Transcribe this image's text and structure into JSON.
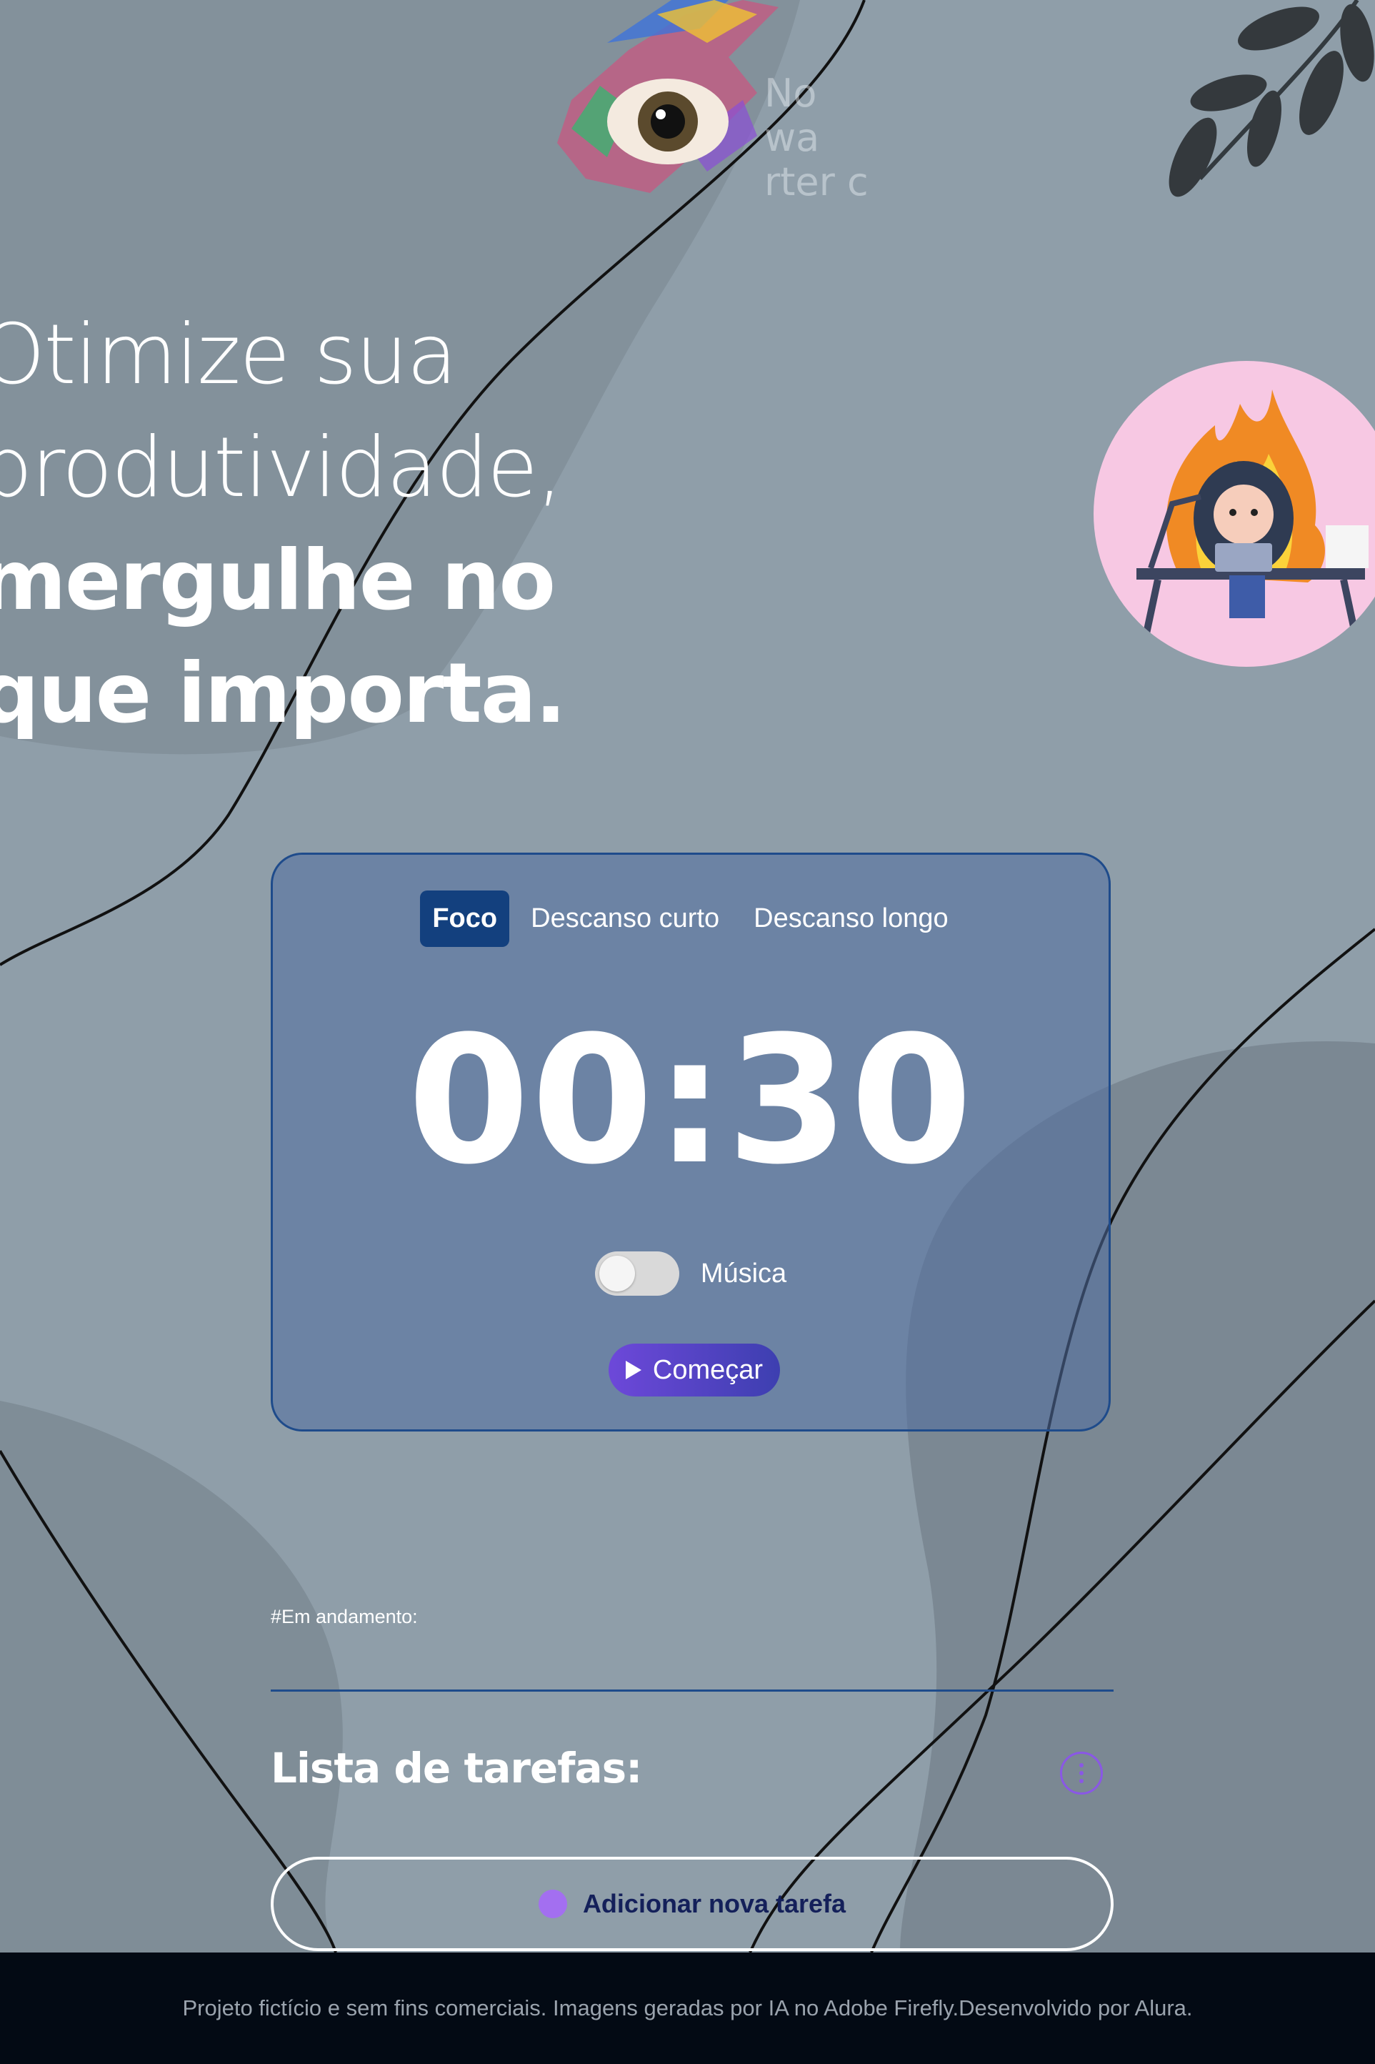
{
  "brand": {
    "watermark_lines": [
      "No wa",
      "rter c"
    ]
  },
  "hero": {
    "line1": "Otimize sua",
    "line2": "produtividade,",
    "line3": "mergulhe no",
    "line4": "que importa."
  },
  "timer": {
    "tabs": [
      {
        "label": "Foco",
        "active": true
      },
      {
        "label": "Descanso curto",
        "active": false
      },
      {
        "label": "Descanso longo",
        "active": false
      }
    ],
    "time": "00:30",
    "music_label": "Música",
    "music_enabled": false,
    "start_label": "Começar"
  },
  "tasks": {
    "in_progress_label": "#Em andamento:",
    "title": "Lista de tarefas:",
    "add_label": "Adicionar nova tarefa"
  },
  "footer": {
    "text": "Projeto fictício e sem fins comerciais. Imagens geradas por IA no Adobe Firefly.Desenvolvido por Alura."
  },
  "colors": {
    "background": "#8f9ea9",
    "card_border": "#1e4b8b",
    "active_tab": "#13407e",
    "button_purple": "#6d48d9",
    "footer_bg": "#030a14"
  }
}
